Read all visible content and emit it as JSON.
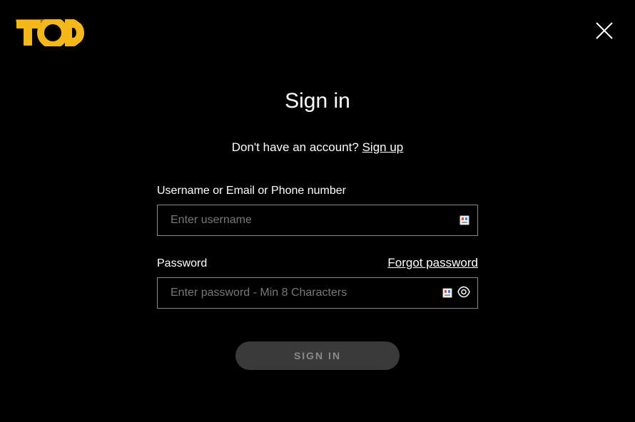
{
  "brand": {
    "name": "TOD",
    "color": "#f4b81a"
  },
  "signin": {
    "title": "Sign in",
    "prompt_text": "Don't have an account? ",
    "signup_link": "Sign up",
    "username_label": "Username or Email or Phone number",
    "username_placeholder": "Enter username",
    "password_label": "Password",
    "forgot_password_link": "Forgot password",
    "password_placeholder": "Enter password - Min 8 Characters",
    "signin_button": "SIGN IN"
  }
}
